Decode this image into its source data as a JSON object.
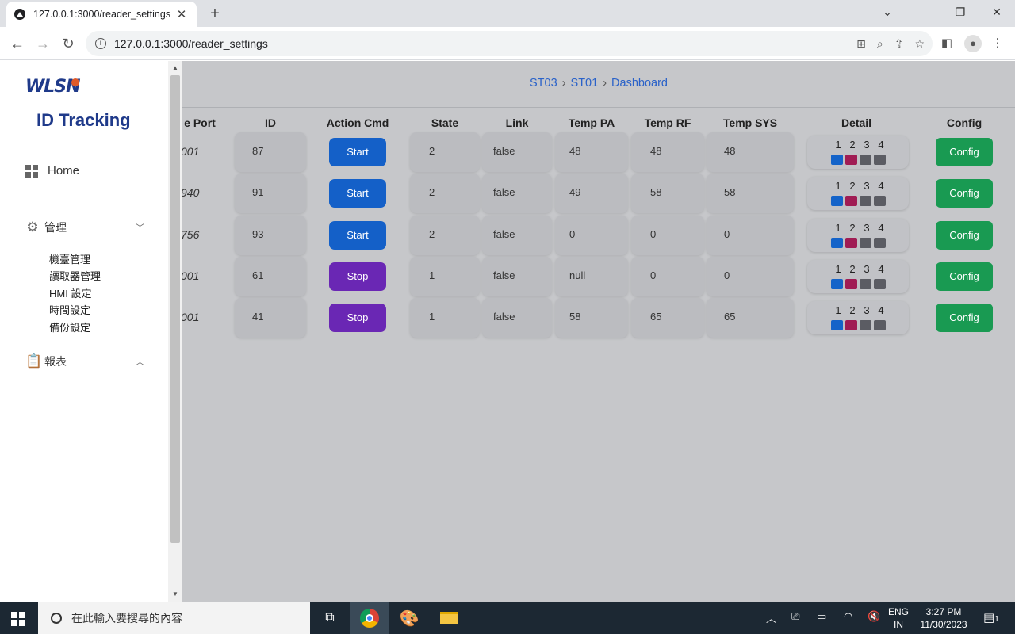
{
  "browser": {
    "tab_title": "127.0.0.1:3000/reader_settings",
    "url": "127.0.0.1:3000/reader_settings"
  },
  "sidebar": {
    "logo_text": "WLSN",
    "brand": "ID Tracking",
    "home": "Home",
    "groups": [
      {
        "label": "管理",
        "items": [
          "機臺管理",
          "讀取器管理",
          "HMI 設定",
          "時間設定",
          "備份設定"
        ]
      },
      {
        "label": "報表"
      }
    ]
  },
  "breadcrumb": [
    "ST03",
    "ST01",
    "Dashboard"
  ],
  "table": {
    "headers": [
      "e Port",
      "ID",
      "Action Cmd",
      "State",
      "Link",
      "Temp PA",
      "Temp RF",
      "Temp SYS",
      "Detail",
      "Config"
    ],
    "detail_labels": [
      "1",
      "2",
      "3",
      "4"
    ],
    "detail_colors": [
      "#1463c9",
      "#a01c54",
      "#5b5c63",
      "#5b5c63"
    ],
    "action_colors": {
      "Start": "#1460c8",
      "Stop": "#6a27b4"
    },
    "config_label": "Config",
    "rows": [
      {
        "port": "001",
        "id": "87",
        "action": "Start",
        "state": "2",
        "link": "false",
        "temp_pa": "48",
        "temp_rf": "48",
        "temp_sys": "48"
      },
      {
        "port": "940",
        "id": "91",
        "action": "Start",
        "state": "2",
        "link": "false",
        "temp_pa": "49",
        "temp_rf": "58",
        "temp_sys": "58"
      },
      {
        "port": "756",
        "id": "93",
        "action": "Start",
        "state": "2",
        "link": "false",
        "temp_pa": "0",
        "temp_rf": "0",
        "temp_sys": "0"
      },
      {
        "port": "001",
        "id": "61",
        "action": "Stop",
        "state": "1",
        "link": "false",
        "temp_pa": "null",
        "temp_rf": "0",
        "temp_sys": "0"
      },
      {
        "port": "001",
        "id": "41",
        "action": "Stop",
        "state": "1",
        "link": "false",
        "temp_pa": "58",
        "temp_rf": "65",
        "temp_sys": "65"
      }
    ]
  },
  "taskbar": {
    "search_placeholder": "在此輸入要搜尋的內容",
    "lang_top": "ENG",
    "lang_bottom": "IN",
    "time": "3:27 PM",
    "date": "11/30/2023",
    "notification_count": "1"
  }
}
